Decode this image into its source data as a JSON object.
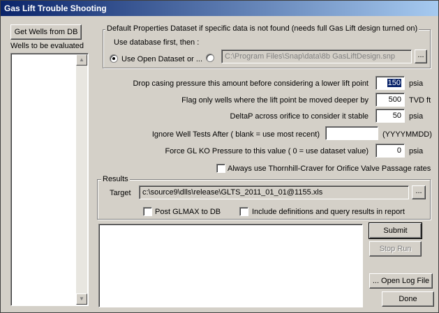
{
  "window": {
    "title": "Gas Lift Trouble Shooting"
  },
  "wells": {
    "get_button": "Get Wells from DB",
    "list_label": "Wells to be evaluated"
  },
  "dataset": {
    "group_label": "Default Properties Dataset if specific data is not found (needs full Gas Lift design turned on)",
    "hint": "Use database first, then :",
    "radio_open_label": "Use Open Dataset",
    "or_label": "or ...",
    "path": "C:\\Program Files\\Snap\\data\\8b GasLiftDesign.snp",
    "browse_label": "..."
  },
  "params": {
    "drop_label": "Drop casing pressure this amount before considering a lower lift point",
    "drop_value": "150",
    "drop_unit": "psia",
    "flag_label": "Flag only wells where the lift point be moved deeper by",
    "flag_value": "500",
    "flag_unit": "TVD ft",
    "deltap_label": "DeltaP across orifice to consider it stable",
    "deltap_value": "50",
    "deltap_unit": "psia",
    "ignore_label": "Ignore Well Tests After ( blank = use most recent)",
    "ignore_value": "",
    "ignore_unit": "(YYYYMMDD)",
    "force_label": "Force GL KO Pressure to this value ( 0 = use dataset value)",
    "force_value": "0",
    "force_unit": "psia",
    "thornhill_label": "Always use Thornhill-Craver for Orifice Valve Passage rates"
  },
  "results": {
    "group_label": "Results",
    "target_label": "Target",
    "target_path": "c:\\source9\\dlls\\release\\GLTS_2011_01_01@1155.xls",
    "browse_label": "...",
    "post_label": "Post GLMAX to DB",
    "include_label": "Include definitions and query results in report"
  },
  "actions": {
    "submit": "Submit",
    "stop": "Stop Run",
    "open_log": "... Open Log File",
    "done": "Done"
  }
}
